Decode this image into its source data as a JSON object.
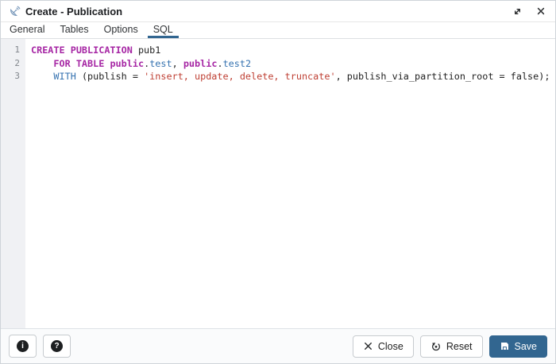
{
  "window": {
    "title": "Create - Publication",
    "icon": "satellite-dish-icon",
    "controls": [
      {
        "name": "maximize",
        "icon": "maximize-icon"
      },
      {
        "name": "close",
        "icon": "close-icon"
      }
    ]
  },
  "tabs": [
    {
      "label": "General",
      "active": false
    },
    {
      "label": "Tables",
      "active": false
    },
    {
      "label": "Options",
      "active": false
    },
    {
      "label": "SQL",
      "active": true
    }
  ],
  "sql_editor": {
    "lines": [
      {
        "number": "1",
        "tokens": [
          {
            "text": "CREATE PUBLICATION",
            "type": "keyword"
          },
          {
            "text": " pub1",
            "type": "plain"
          }
        ]
      },
      {
        "number": "2",
        "tokens": [
          {
            "text": "    ",
            "type": "plain"
          },
          {
            "text": "FOR TABLE",
            "type": "keyword"
          },
          {
            "text": " ",
            "type": "plain"
          },
          {
            "text": "public",
            "type": "keyword"
          },
          {
            "text": ".",
            "type": "plain"
          },
          {
            "text": "test",
            "type": "identifier"
          },
          {
            "text": ", ",
            "type": "plain"
          },
          {
            "text": "public",
            "type": "keyword"
          },
          {
            "text": ".",
            "type": "plain"
          },
          {
            "text": "test2",
            "type": "identifier"
          }
        ]
      },
      {
        "number": "3",
        "tokens": [
          {
            "text": "    ",
            "type": "plain"
          },
          {
            "text": "WITH",
            "type": "identifier"
          },
          {
            "text": " (publish = ",
            "type": "plain"
          },
          {
            "text": "'insert, update, delete, truncate'",
            "type": "string"
          },
          {
            "text": ", publish_via_partition_root = false);",
            "type": "plain"
          }
        ]
      }
    ]
  },
  "footer": {
    "info_glyph": "i",
    "help_glyph": "?",
    "close_label": "Close",
    "reset_label": "Reset",
    "save_label": "Save"
  },
  "colors": {
    "accent": "#326690",
    "keyword": "#a626a4",
    "identifier": "#3572b0",
    "string": "#bf4034",
    "plain": "#222222",
    "gutter_bg": "#f0f1f4",
    "line_number": "#81868c"
  }
}
